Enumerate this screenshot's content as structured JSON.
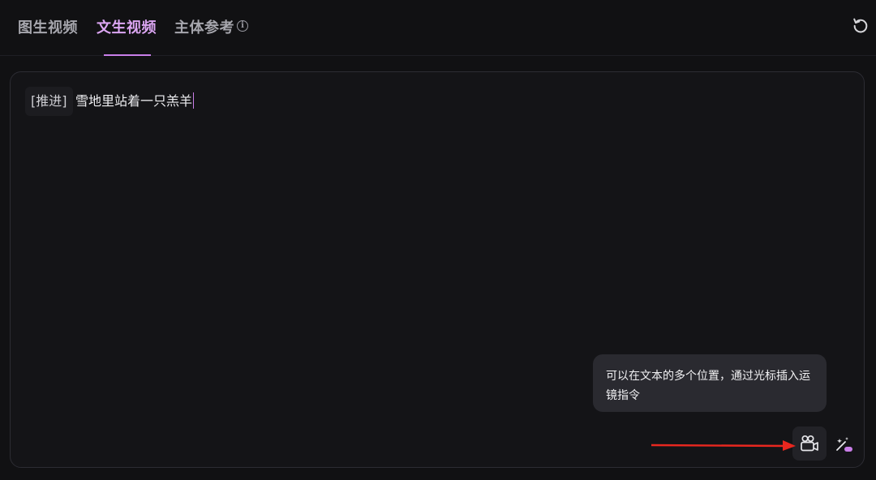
{
  "tabs": [
    {
      "label": "图生视频",
      "active": false
    },
    {
      "label": "文生视频",
      "active": true
    },
    {
      "label": "主体参考",
      "active": false
    }
  ],
  "tab_info_icon": "info-icon",
  "header": {
    "reset_icon": "refresh-icon"
  },
  "editor": {
    "command_chip": "[推进]",
    "prompt_text": "雪地里站着一只羔羊"
  },
  "tooltip": {
    "text": "可以在文本的多个位置，通过光标插入运镜指令"
  },
  "actions": {
    "camera_icon": "camera-movie-icon",
    "magic_icon": "magic-wand-icon"
  },
  "colors": {
    "accent": "#dca6f3",
    "underline": "#c97ee8",
    "background": "#111113",
    "arrow": "#e8271f"
  }
}
